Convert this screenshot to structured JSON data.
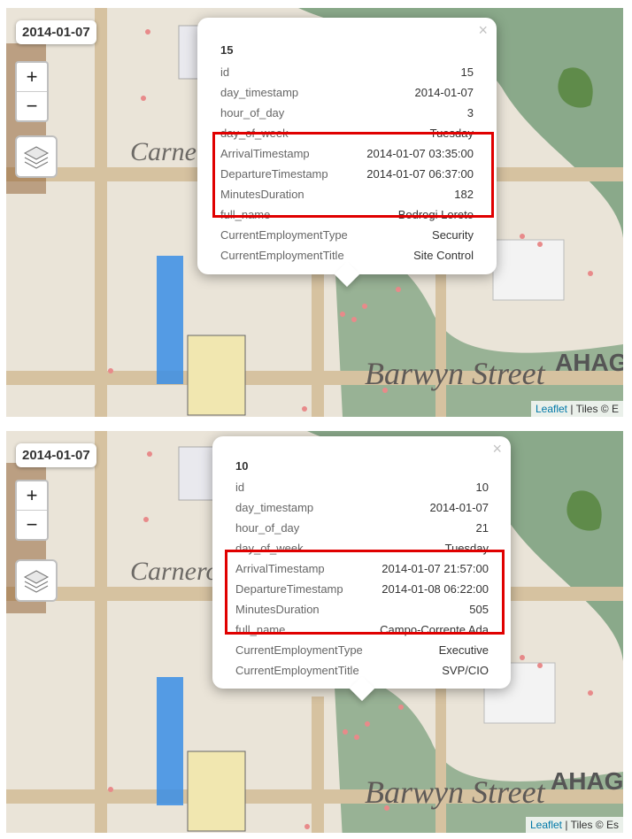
{
  "panels": [
    {
      "date_badge": "2014-01-07",
      "zoom": {
        "in": "+",
        "out": "−"
      },
      "street_labels": [
        "Carnero St",
        "Barwyn Street",
        "AHAG"
      ],
      "attribution": {
        "link": "Leaflet",
        "rest": " | Tiles © E"
      },
      "popup": {
        "close": "×",
        "title": "15",
        "rows": [
          {
            "key": "id",
            "value": "15"
          },
          {
            "key": "day_timestamp",
            "value": "2014-01-07"
          },
          {
            "key": "hour_of_day",
            "value": "3"
          },
          {
            "key": "day_of_week",
            "value": "Tuesday"
          },
          {
            "key": "ArrivalTimestamp",
            "value": "2014-01-07 03:35:00"
          },
          {
            "key": "DepartureTimestamp",
            "value": "2014-01-07 06:37:00"
          },
          {
            "key": "MinutesDuration",
            "value": "182"
          },
          {
            "key": "full_name",
            "value": "Bodrogi Loreto"
          },
          {
            "key": "CurrentEmploymentType",
            "value": "Security"
          },
          {
            "key": "CurrentEmploymentTitle",
            "value": "Site Control"
          }
        ]
      }
    },
    {
      "date_badge": "2014-01-07",
      "zoom": {
        "in": "+",
        "out": "−"
      },
      "street_labels": [
        "Carnero St",
        "Barwyn Street",
        "AHAG"
      ],
      "attribution": {
        "link": "Leaflet",
        "rest": " | Tiles © Es"
      },
      "popup": {
        "close": "×",
        "title": "10",
        "rows": [
          {
            "key": "id",
            "value": "10"
          },
          {
            "key": "day_timestamp",
            "value": "2014-01-07"
          },
          {
            "key": "hour_of_day",
            "value": "21"
          },
          {
            "key": "day_of_week",
            "value": "Tuesday"
          },
          {
            "key": "ArrivalTimestamp",
            "value": "2014-01-07 21:57:00"
          },
          {
            "key": "DepartureTimestamp",
            "value": "2014-01-08 06:22:00"
          },
          {
            "key": "MinutesDuration",
            "value": "505"
          },
          {
            "key": "full_name",
            "value": "Campo-Corrente Ada"
          },
          {
            "key": "CurrentEmploymentType",
            "value": "Executive"
          },
          {
            "key": "CurrentEmploymentTitle",
            "value": "SVP/CIO"
          }
        ]
      }
    }
  ],
  "colors": {
    "highlight": "#e00000",
    "link": "#0078A8",
    "map_bg": "#ece7dc",
    "road": "#d9c6a6",
    "park": "#8aa98a"
  },
  "icons": [
    "zoom-in-icon",
    "zoom-out-icon",
    "layers-icon",
    "close-icon"
  ]
}
